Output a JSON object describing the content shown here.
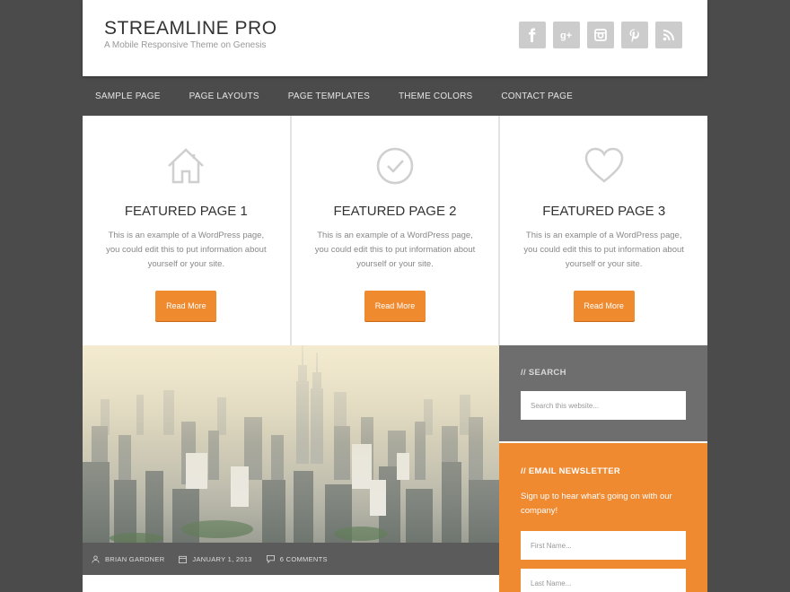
{
  "header": {
    "site_title": "STREAMLINE PRO",
    "site_description": "A Mobile Responsive Theme on Genesis",
    "social_icons": [
      "facebook-icon",
      "google-plus-icon",
      "instagram-icon",
      "pinterest-icon",
      "rss-icon"
    ]
  },
  "nav": {
    "items": [
      {
        "label": "SAMPLE PAGE"
      },
      {
        "label": "PAGE LAYOUTS"
      },
      {
        "label": "PAGE TEMPLATES"
      },
      {
        "label": "THEME COLORS"
      },
      {
        "label": "CONTACT PAGE"
      }
    ]
  },
  "featured": [
    {
      "icon": "home-icon",
      "title": "FEATURED PAGE 1",
      "text": "This is an example of a WordPress page, you could edit this to put information about yourself or your site.",
      "button": "Read More"
    },
    {
      "icon": "checkmark-circle-icon",
      "title": "FEATURED PAGE 2",
      "text": "This is an example of a WordPress page, you could edit this to put information about yourself or your site.",
      "button": "Read More"
    },
    {
      "icon": "heart-icon",
      "title": "FEATURED PAGE 3",
      "text": "This is an example of a WordPress page, you could edit this to put information about yourself or your site.",
      "button": "Read More"
    }
  ],
  "post": {
    "author": "BRIAN GARDNER",
    "date": "JANUARY 1, 2013",
    "comments": "6 COMMENTS"
  },
  "sidebar": {
    "search": {
      "title": "//  SEARCH",
      "placeholder": "Search this website..."
    },
    "newsletter": {
      "title": "//  EMAIL NEWSLETTER",
      "text": "Sign up to hear what's going on with our company!",
      "first_name_placeholder": "First Name...",
      "last_name_placeholder": "Last Name..."
    }
  },
  "colors": {
    "background": "#4b4b4b",
    "accent_orange": "#f08a2e",
    "search_widget": "#6e6e6e",
    "meta_bar": "#5b5b5b"
  }
}
